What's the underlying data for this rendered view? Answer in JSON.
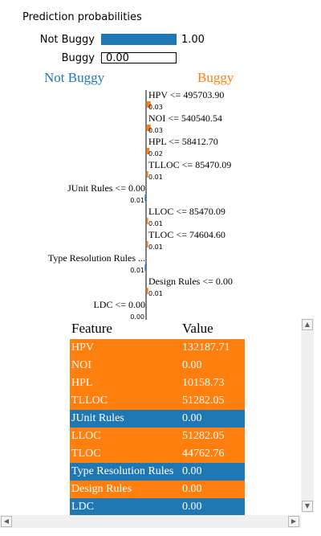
{
  "prediction": {
    "title": "Prediction probabilities",
    "rows": [
      {
        "label": "Not Buggy",
        "value": 1.0,
        "text": "1.00",
        "color": "#1f77b4"
      },
      {
        "label": "Buggy",
        "value": 0.0,
        "text": "0.00",
        "color": "#ff7f0e"
      }
    ]
  },
  "classes": {
    "left": "Not Buggy",
    "right": "Buggy"
  },
  "colors": {
    "not_buggy": "#1f77b4",
    "buggy": "#ff7f0e"
  },
  "chart_data": {
    "type": "bar",
    "orientation": "horizontal",
    "features": [
      {
        "condition": "HPV <= 495703.90",
        "weight": 0.03,
        "label": "0.03",
        "side": "Buggy"
      },
      {
        "condition": "NOI <= 540540.54",
        "weight": 0.03,
        "label": "0.03",
        "side": "Buggy"
      },
      {
        "condition": "HPL <= 58412.70",
        "weight": 0.02,
        "label": "0.02",
        "side": "Buggy"
      },
      {
        "condition": "TLLOC <= 85470.09",
        "weight": 0.01,
        "label": "0.01",
        "side": "Buggy"
      },
      {
        "condition": "JUnit Rules <= 0.00",
        "weight": 0.01,
        "label": "0.01",
        "side": "Not Buggy"
      },
      {
        "condition": "LLOC <= 85470.09",
        "weight": 0.01,
        "label": "0.01",
        "side": "Buggy"
      },
      {
        "condition": "TLOC <= 74604.60",
        "weight": 0.01,
        "label": "0.01",
        "side": "Buggy"
      },
      {
        "condition": "Type Resolution Rules ...",
        "weight": 0.01,
        "label": "0.01",
        "side": "Not Buggy"
      },
      {
        "condition": "Design Rules <= 0.00",
        "weight": 0.01,
        "label": "0.01",
        "side": "Buggy"
      },
      {
        "condition": "LDC <= 0.00",
        "weight": 0.0,
        "label": "0.00",
        "side": "Not Buggy"
      }
    ]
  },
  "table": {
    "headers": [
      "Feature",
      "Value"
    ],
    "rows": [
      {
        "feature": "HPV",
        "value": "132187.71",
        "side": "Buggy"
      },
      {
        "feature": "NOI",
        "value": "0.00",
        "side": "Buggy"
      },
      {
        "feature": "HPL",
        "value": "10158.73",
        "side": "Buggy"
      },
      {
        "feature": "TLLOC",
        "value": "51282.05",
        "side": "Buggy"
      },
      {
        "feature": "JUnit Rules",
        "value": "0.00",
        "side": "Not Buggy"
      },
      {
        "feature": "LLOC",
        "value": "51282.05",
        "side": "Buggy"
      },
      {
        "feature": "TLOC",
        "value": "44762.76",
        "side": "Buggy"
      },
      {
        "feature": "Type Resolution Rules",
        "value": "0.00",
        "side": "Not Buggy"
      },
      {
        "feature": "Design Rules",
        "value": "0.00",
        "side": "Buggy"
      },
      {
        "feature": "LDC",
        "value": "0.00",
        "side": "Not Buggy"
      }
    ]
  },
  "scrollbar_icons": [
    "arrow-up-icon",
    "arrow-down-icon",
    "arrow-left-icon",
    "arrow-right-icon"
  ]
}
